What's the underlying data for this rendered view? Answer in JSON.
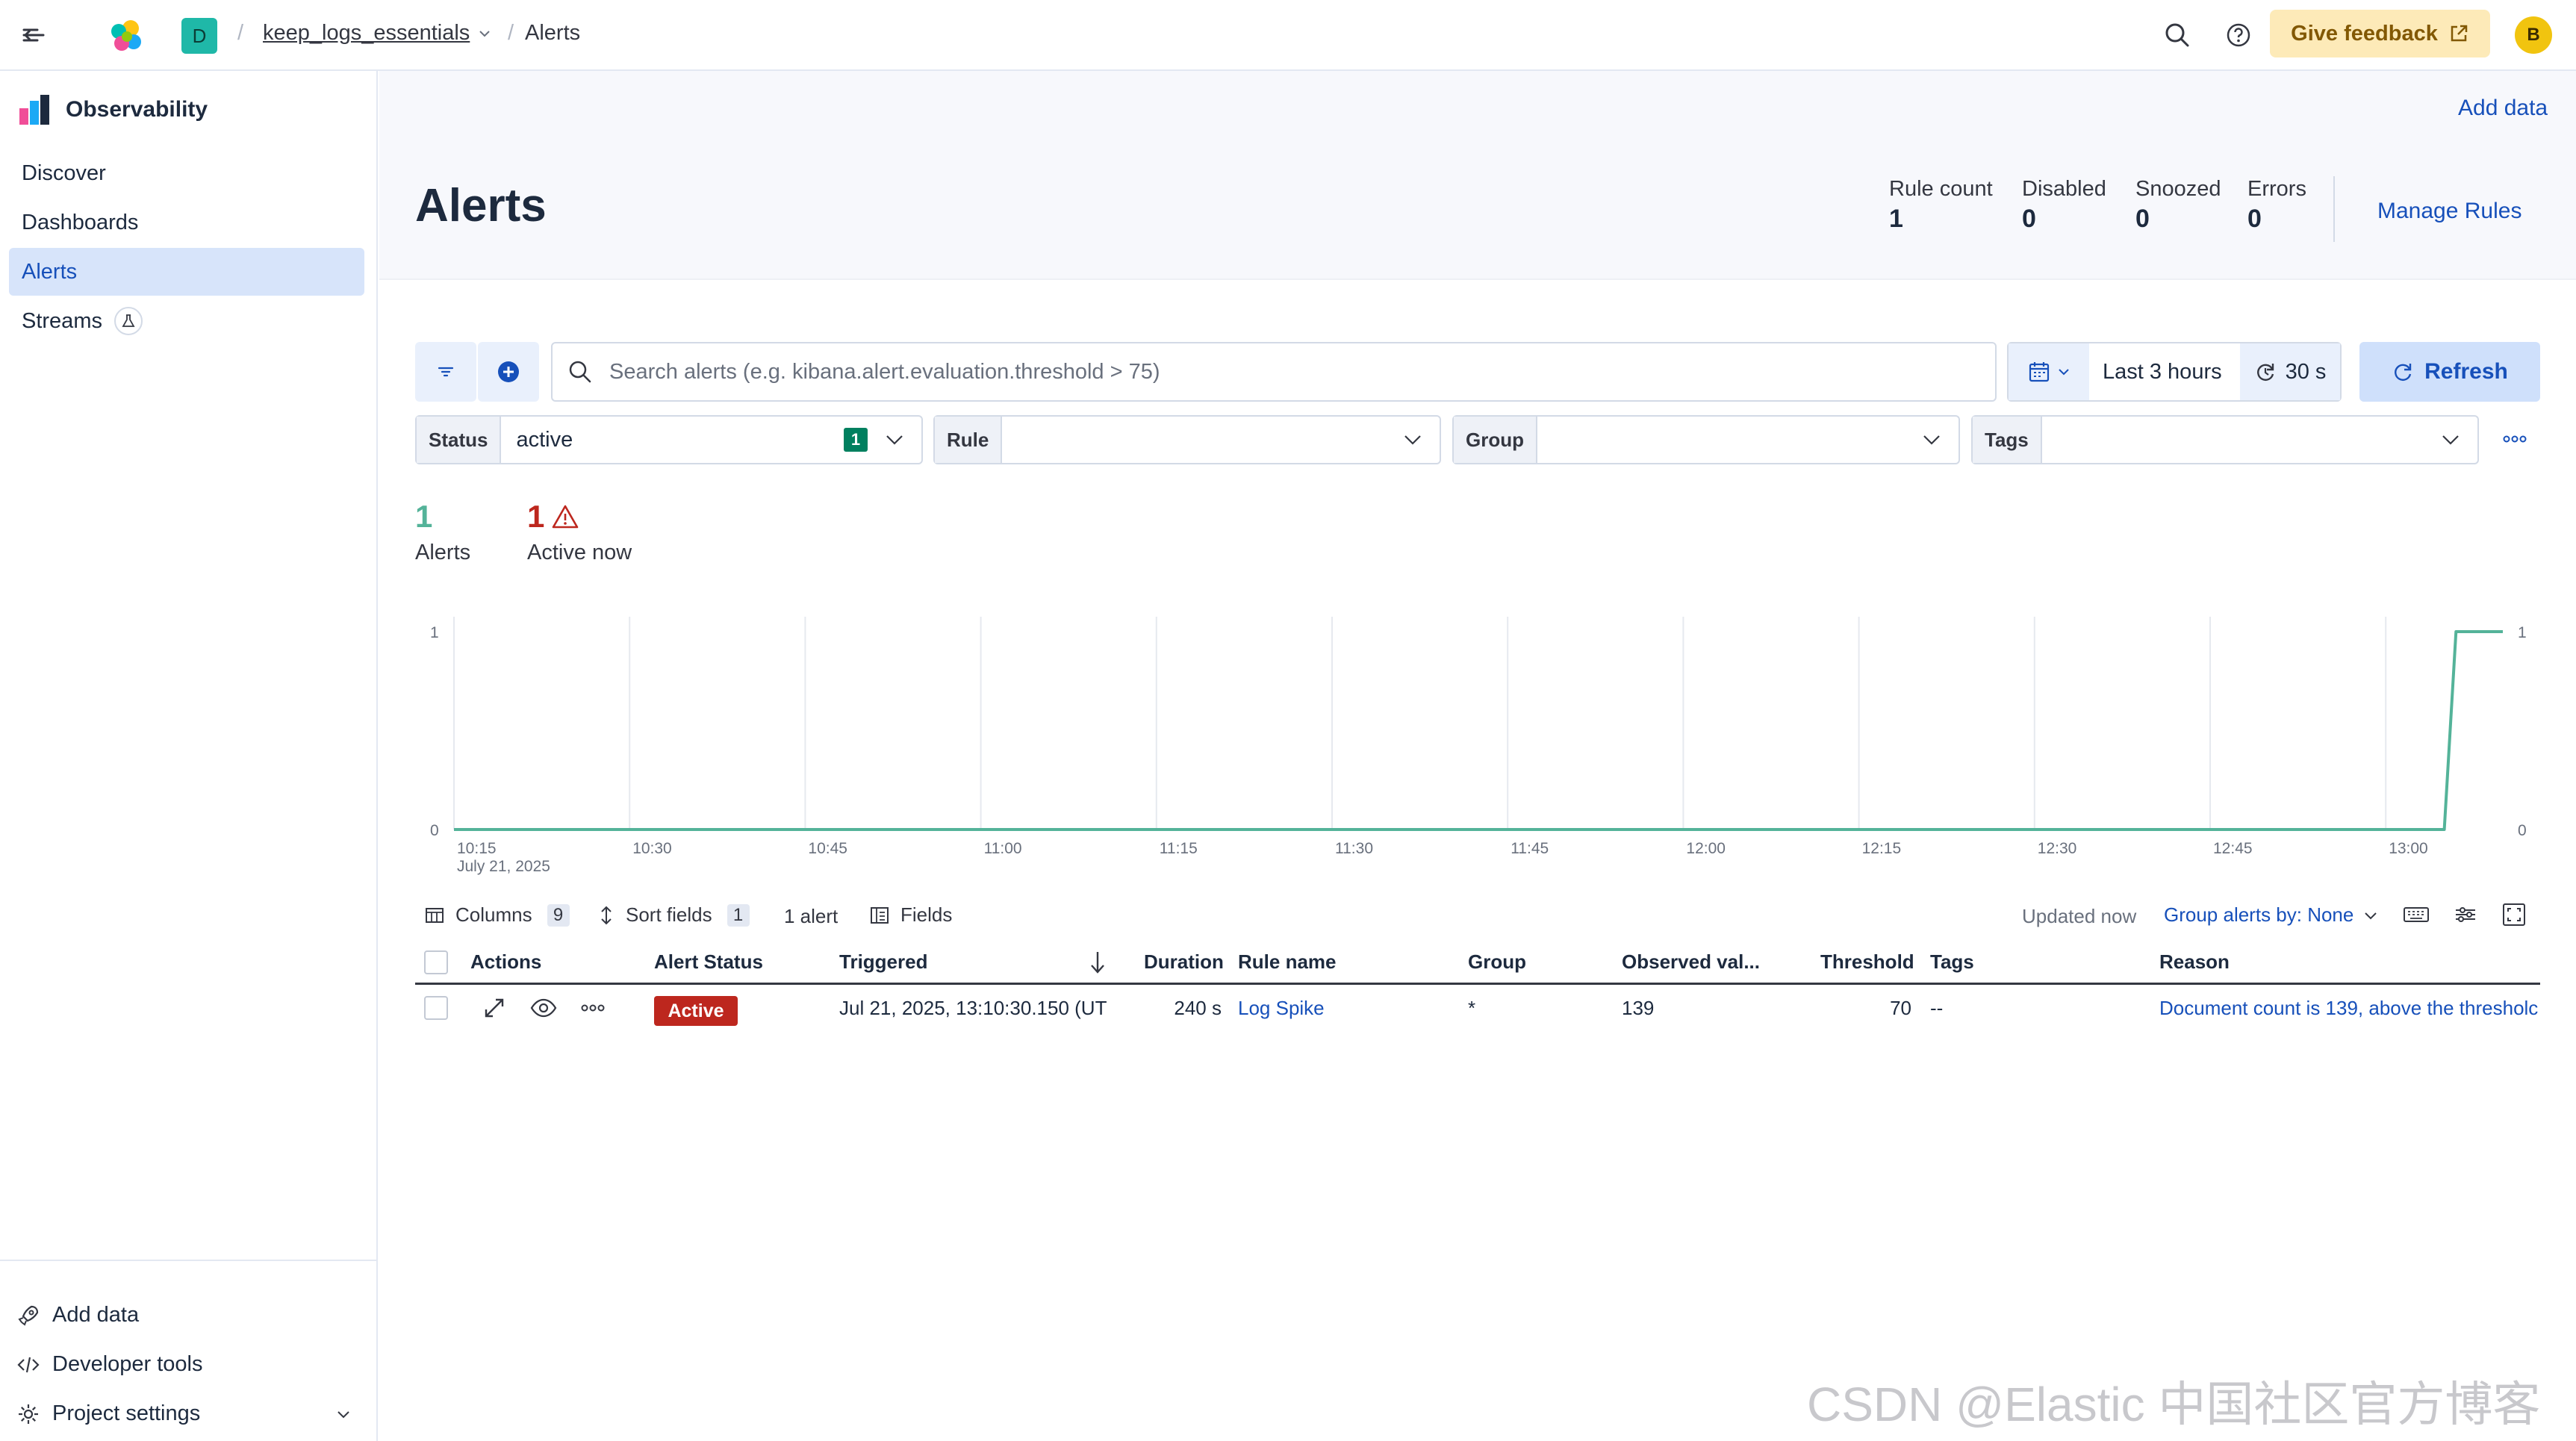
{
  "header": {
    "space_initial": "D",
    "breadcrumb_project": "keep_logs_essentials",
    "breadcrumb_page": "Alerts",
    "feedback_label": "Give feedback",
    "user_initial": "B"
  },
  "sidebar": {
    "title": "Observability",
    "items": [
      {
        "label": "Discover"
      },
      {
        "label": "Dashboards"
      },
      {
        "label": "Alerts"
      },
      {
        "label": "Streams"
      }
    ],
    "bottom": [
      {
        "label": "Add data"
      },
      {
        "label": "Developer tools"
      },
      {
        "label": "Project settings"
      }
    ]
  },
  "page": {
    "add_data": "Add data",
    "title": "Alerts",
    "stats": [
      {
        "label": "Rule count",
        "value": "1"
      },
      {
        "label": "Disabled",
        "value": "0"
      },
      {
        "label": "Snoozed",
        "value": "0"
      },
      {
        "label": "Errors",
        "value": "0"
      }
    ],
    "manage_rules": "Manage Rules"
  },
  "query": {
    "search_placeholder": "Search alerts (e.g. kibana.alert.evaluation.threshold > 75)",
    "time_range": "Last 3 hours",
    "refresh_interval": "30 s",
    "refresh_label": "Refresh"
  },
  "filters": {
    "status_label": "Status",
    "status_value": "active",
    "status_count": "1",
    "rule_label": "Rule",
    "group_label": "Group",
    "tags_label": "Tags"
  },
  "summary": {
    "alerts_count": "1",
    "alerts_label": "Alerts",
    "active_count": "1",
    "active_label": "Active now"
  },
  "chart_data": {
    "type": "line",
    "x": [
      "10:15",
      "10:30",
      "10:45",
      "11:00",
      "11:15",
      "11:30",
      "11:45",
      "12:00",
      "12:15",
      "12:30",
      "12:45",
      "13:00",
      "13:05",
      "13:06",
      "13:10"
    ],
    "series": [
      {
        "values": [
          0,
          0,
          0,
          0,
          0,
          0,
          0,
          0,
          0,
          0,
          0,
          0,
          0,
          1,
          1
        ]
      }
    ],
    "x_ticks": [
      "10:15",
      "10:30",
      "10:45",
      "11:00",
      "11:15",
      "11:30",
      "11:45",
      "12:00",
      "12:15",
      "12:30",
      "12:45",
      "13:00"
    ],
    "x_date_label": "July 21, 2025",
    "y_ticks": [
      "0",
      "1"
    ],
    "ylim": [
      0,
      1
    ],
    "grid": true,
    "color": "#54b399"
  },
  "table_toolbar": {
    "columns_label": "Columns",
    "columns_count": "9",
    "sort_label": "Sort fields",
    "sort_count": "1",
    "alert_count": "1 alert",
    "fields_label": "Fields",
    "updated": "Updated now",
    "group_by": "Group alerts by: None"
  },
  "table": {
    "headers": [
      "Actions",
      "Alert Status",
      "Triggered",
      "Duration",
      "Rule name",
      "Group",
      "Observed val...",
      "Threshold",
      "Tags",
      "Reason"
    ],
    "row": {
      "status": "Active",
      "triggered": "Jul 21, 2025, 13:10:30.150 (UT",
      "duration": "240 s",
      "rule_name": "Log Spike",
      "group": "*",
      "observed": "139",
      "threshold": "70",
      "tags": "--",
      "reason": "Document count is 139, above the thresholc"
    }
  },
  "watermark": "CSDN @Elastic 中国社区官方博客"
}
